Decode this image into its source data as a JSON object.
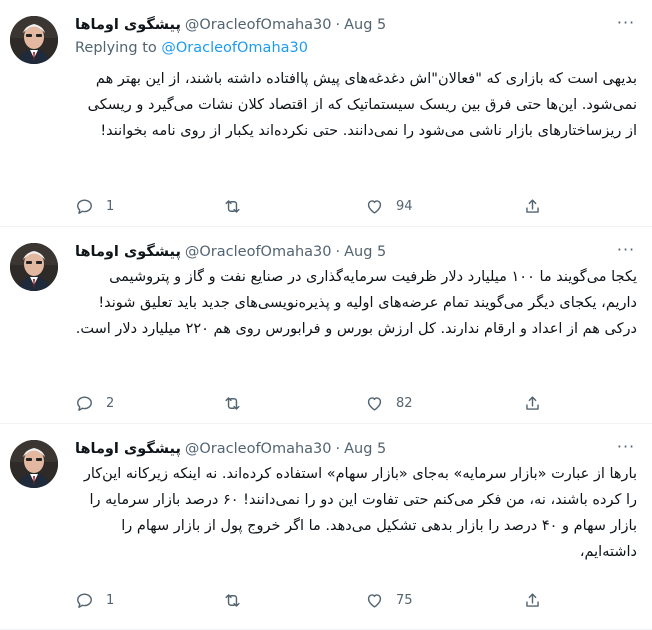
{
  "colors": {
    "link": "#1d9bf0",
    "muted": "#536471",
    "text": "#0f1419",
    "divider": "#eff3f4"
  },
  "tweets": [
    {
      "name": "پیشگوی اوماها",
      "handle": "@OracleofOmaha30",
      "separator": "·",
      "date": "Aug 5",
      "more_label": "···",
      "replying_prefix": "Replying to",
      "replying_handle": "@OracleofOmaha30",
      "text": "بدیهی است که بازاری که \"فعالان\"اش دغدغه‌های پیش پاافتاده داشته باشند، از این بهتر هم نمی‌شود. این‌ها حتی فرق بین ریسک سیستماتیک که از اقتصاد کلان نشات می‌گیرد و ریسکی از ریزساختارهای بازار ناشی می‌شود را نمی‌دانند. حتی نکرده‌اند یکبار از روی نامه بخوانند!",
      "reply_count": "1",
      "retweet_count": "",
      "like_count": "94"
    },
    {
      "name": "پیشگوی اوماها",
      "handle": "@OracleofOmaha30",
      "separator": "·",
      "date": "Aug 5",
      "more_label": "···",
      "text": "یکجا می‌گویند ما ۱۰۰ میلیارد دلار ظرفیت سرمایه‌گذاری در صنایع نفت و گاز و پتروشیمی داریم، یکجای دیگر می‌گویند تمام عرضه‌های اولیه و پذیره‌نویسی‌های جدید باید تعلیق شوند! درکی هم از اعداد و ارقام ندارند. کل ارزش بورس و فرابورس روی هم ۲۲۰ میلیارد دلار است.",
      "reply_count": "2",
      "retweet_count": "",
      "like_count": "82"
    },
    {
      "name": "پیشگوی اوماها",
      "handle": "@OracleofOmaha30",
      "separator": "·",
      "date": "Aug 5",
      "more_label": "···",
      "text": "بارها از عبارت «بازار سرمایه» به‌جای «بازار سهام» استفاده کرده‌اند. نه اینکه زیرکانه این‌کار را کرده باشند، نه، من فکر می‌کنم حتی تفاوت این دو را نمی‌دانند! ۶۰ درصد بازار سرمایه را بازار سهام و ۴۰ درصد را بازار بدهی تشکیل می‌دهد. ما اگر خروج پول از بازار سهام را داشته‌ایم،",
      "reply_count": "1",
      "retweet_count": "",
      "like_count": "75"
    }
  ]
}
